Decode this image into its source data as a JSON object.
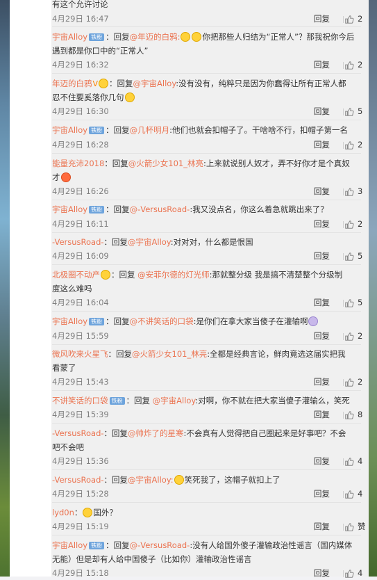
{
  "labels": {
    "reply": "回复",
    "reply_prefix": "：回复",
    "praise": "赞"
  },
  "comments": [
    {
      "user": "",
      "text": "有这个允许讨论",
      "time": "4月29日 16:47",
      "likes": "2"
    },
    {
      "user": "宇宙Alloy",
      "badge": "铁粉",
      "target": "@年迈的白鸦:",
      "text": "你把那些人归结为“正常人”？那我祝你今后",
      "text2": "遇到都是你口中的“正常人”",
      "time": "4月29日 16:32",
      "likes": "2"
    },
    {
      "user": "年迈的白鸦",
      "target": "@宇宙Alloy",
      "text": ":没有没有，纯粹只是因为你蠢得让所有正常人都",
      "text2": "忍不住要奚落你几句",
      "time": "4月29日 16:30",
      "likes": "5"
    },
    {
      "user": "宇宙Alloy",
      "badge": "铁粉",
      "target": "@几杯明月",
      "text": ":他们也就会扣帽子了。干啥啥不行，扣帽子第一名",
      "time": "4月29日 16:28",
      "likes": "2"
    },
    {
      "user": "能量充沛2018",
      "target": "@火箭少女101_林亮",
      "text": ":上来就说别人奴才，弄不好你才是个真奴",
      "text2": "才",
      "time": "4月29日 16:26",
      "likes": "3"
    },
    {
      "user": "宇宙Alloy",
      "badge": "铁粉",
      "target": "@-VersusRoad-",
      "text": ":我又没点名，你这么着急就跳出来了？",
      "time": "4月29日 16:11",
      "likes": "2"
    },
    {
      "user": "-VersusRoad-",
      "target": "@宇宙Alloy",
      "text": ":对对对，什么都是恨国",
      "time": "4月29日 16:09",
      "likes": "5"
    },
    {
      "user": "北极圈不动产",
      "target": "@安菲尔德的灯光师",
      "text": ":那就整分级 我是搞不清楚整个分级制",
      "text2": "度这么难吗",
      "time": "4月29日 16:04",
      "likes": "5"
    },
    {
      "user": "宇宙Alloy",
      "badge": "铁粉",
      "target": "@不讲笑话的口袋",
      "text": ":是你们在拿大家当傻子在灌输啊",
      "time": "4月29日 15:59",
      "likes": "2"
    },
    {
      "user": "微风吹来火星飞",
      "target": "@火箭少女101_林亮",
      "text": ":全都是经典言论，鲜肉竟选这届实把我",
      "text2": "看蒙了",
      "time": "4月29日 15:43",
      "likes": "2"
    },
    {
      "user": "不讲笑话的口袋",
      "badge": "铁粉",
      "target": "@宇宙Alloy",
      "text": ":对啊，你不就在把大家当傻子灌输么，笑死",
      "time": "4月29日 15:39",
      "likes": "8"
    },
    {
      "user": "-VersusRoad-",
      "target": "@帅炸了的星寒",
      "text": ":不会真有人觉得把自己圈起来是好事吧？不会",
      "text2": "吧不会吧",
      "time": "4月29日 15:36",
      "likes": "4"
    },
    {
      "user": "-VersusRoad-",
      "target": "@宇宙Alloy:",
      "text": "笑死我了，这帽子就扣上了",
      "time": "4月29日 15:28",
      "likes": "4"
    },
    {
      "user": "lyd0n",
      "text": "国外？",
      "time": "4月29日 15:19",
      "likes": "赞"
    },
    {
      "user": "宇宙Alloy",
      "badge": "铁粉",
      "target": "@-VersusRoad-",
      "text": ":没有人给国外傻子灌输政治性谣言（国内媒体",
      "text2": "无能）但是却有人给中国傻子（比如你）灌输政治性谣言",
      "time": "4月29日 15:18",
      "likes": "4"
    }
  ]
}
